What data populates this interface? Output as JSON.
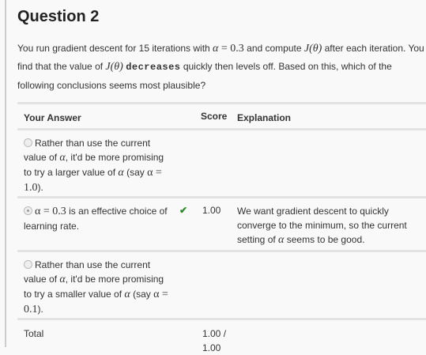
{
  "title": "Question 2",
  "question": {
    "p1": "You run gradient descent for 15 iterations with ",
    "alpha": "α",
    "eq": " = 0.3",
    "p2": " and compute ",
    "J": "J(θ)",
    "p3": " after each iteration. You find that the value of ",
    "J2": "J(θ)",
    "dec": "decreases",
    "p4": " quickly then levels off. Based on this, which of the following conclusions seems most plausible?"
  },
  "headers": {
    "answer": "Your Answer",
    "score": "Score",
    "explanation": "Explanation"
  },
  "options": [
    {
      "a": "Rather than use the current value of ",
      "alpha": "α",
      "b": ", it'd be more promising to try a larger value of ",
      "alpha2": "α",
      "c": " (say ",
      "math": "α = 1.0",
      "d": ")."
    },
    {
      "math": "α = 0.3",
      "a": " is an effective choice of learning rate.",
      "score": "1.00",
      "check": "✔",
      "exp_a": "We want gradient descent to quickly converge to the minimum, so the current setting of ",
      "exp_alpha": "α",
      "exp_b": " seems to be good."
    },
    {
      "a": "Rather than use the current value of ",
      "alpha": "α",
      "b": ", it'd be more promising to try a smaller value of ",
      "alpha2": "α",
      "c": " (say ",
      "math": "α = 0.1",
      "d": ")."
    }
  ],
  "total": {
    "label": "Total",
    "score": "1.00 / 1.00"
  }
}
